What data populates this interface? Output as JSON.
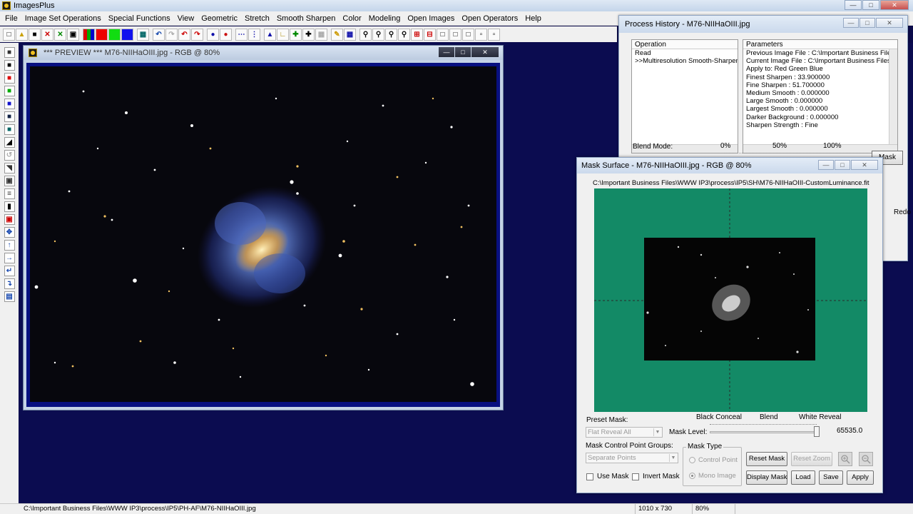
{
  "app": {
    "title": "ImagesPlus"
  },
  "menu": [
    "File",
    "Image Set Operations",
    "Special Functions",
    "View",
    "Geometric",
    "Stretch",
    "Smooth Sharpen",
    "Color",
    "Modeling",
    "Open Images",
    "Open Operators",
    "Help"
  ],
  "preview_window": {
    "title": "*** PREVIEW *** M76-NIIHaOIII.jpg - RGB @ 80%"
  },
  "process_history": {
    "title": "Process History - M76-NIIHaOIII.jpg",
    "operation_header": "Operation",
    "operations": [
      "Read",
      ">>Multiresolution Smooth-Sharpen"
    ],
    "parameters_header": "Parameters",
    "parameters": [
      "Previous Image File : C:\\Important Business Files\\WW",
      "Current Image File : C:\\Important Business Files\\WW",
      "Apply to:  Red Green Blue",
      "Finest Sharpen : 33.900000",
      "Fine Sharpen : 51.700000",
      "Medium Smooth : 0.000000",
      "Large Smooth : 0.000000",
      "Largest Smooth : 0.000000",
      "Darker Background : 0.000000",
      "Sharpen Strength : Fine"
    ],
    "blend_mode_label": "Blend Mode:",
    "pct_0": "0%",
    "pct_50": "50%",
    "pct_100": "100%",
    "mask_button": "Mask",
    "redo_stub": "Redo"
  },
  "mask_surface": {
    "title": "Mask Surface - M76-NIIHaOIII.jpg - RGB @ 80%",
    "path": "C:\\Important Business Files\\WWW IP3\\process\\IP5\\SH\\M76-NIIHaOIII-CustomLuminance.fit",
    "preset_mask_label": "Preset Mask:",
    "preset_mask_value": "Flat Reveal All",
    "black_conceal": "Black Conceal",
    "blend": "Blend",
    "white_reveal": "White Reveal",
    "mask_level_label": "Mask Level:",
    "mask_level_value": "65535.0",
    "mask_level_fraction": 1.0,
    "control_groups_label": "Mask Control Point Groups:",
    "control_groups_value": "Separate Points",
    "mask_type_label": "Mask Type",
    "radio_control_point": "Control Point",
    "radio_mono_image": "Mono Image",
    "use_mask": "Use Mask",
    "invert_mask": "Invert Mask",
    "reset_mask": "Reset Mask",
    "reset_zoom": "Reset Zoom",
    "display_mask": "Display Mask",
    "load": "Load",
    "save": "Save",
    "apply": "Apply"
  },
  "statusbar": {
    "path": "C:\\Important Business Files\\WWW IP3\\process\\IP5\\PH-AF\\M76-NIIHaOIII.jpg",
    "dimensions": "1010 x 730",
    "zoom": "80%"
  },
  "colors": {
    "workspace_bg": "#0b0c50",
    "mask_bg": "#138a66",
    "preview_frame": "#081080"
  }
}
